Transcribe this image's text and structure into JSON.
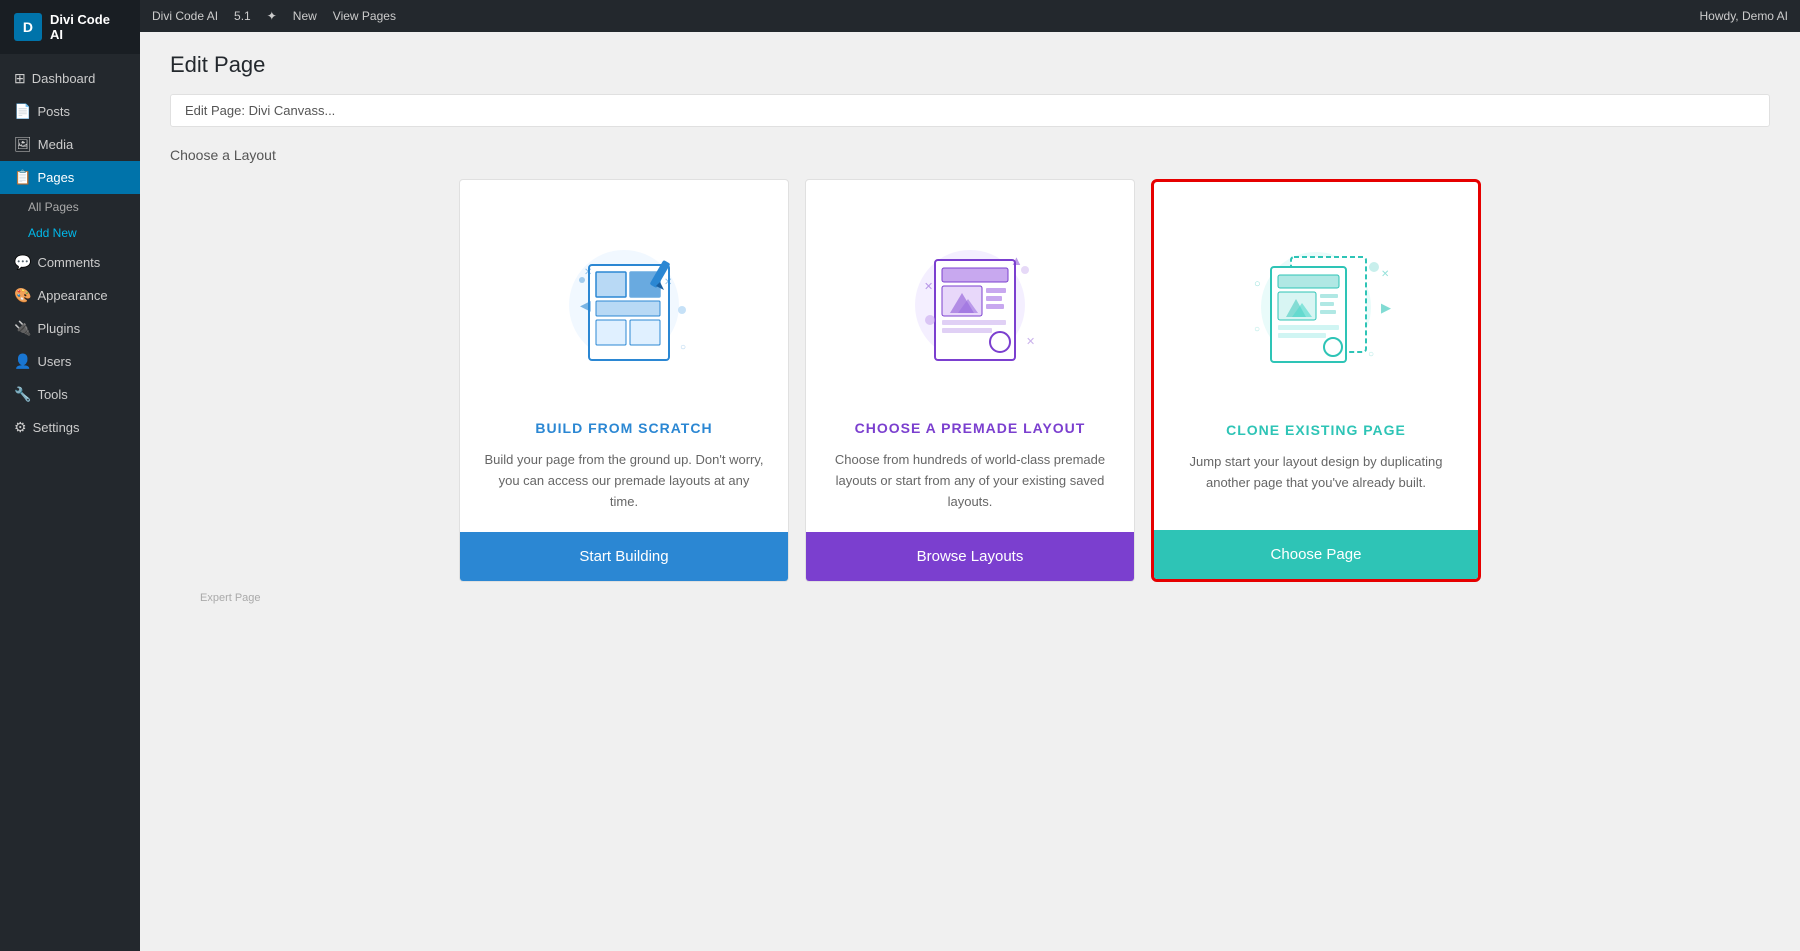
{
  "sidebar": {
    "logo": "Divi Code AI",
    "items": [
      {
        "label": "Dashboard",
        "icon": "⊞",
        "active": false
      },
      {
        "label": "Posts",
        "icon": "📄",
        "active": false
      },
      {
        "label": "Media",
        "icon": "🖼",
        "active": false
      },
      {
        "label": "Pages",
        "icon": "📋",
        "active": true
      },
      {
        "label": "All Pages",
        "icon": "",
        "active": false,
        "sub": true
      },
      {
        "label": "Add New",
        "icon": "",
        "active": true,
        "sub": true
      },
      {
        "label": "Comments",
        "icon": "💬",
        "active": false
      },
      {
        "label": "Appearance",
        "icon": "🎨",
        "active": false
      },
      {
        "label": "Plugins",
        "icon": "🔌",
        "active": false
      },
      {
        "label": "Users",
        "icon": "👤",
        "active": false
      },
      {
        "label": "Tools",
        "icon": "🔧",
        "active": false
      },
      {
        "label": "Settings",
        "icon": "⚙",
        "active": false
      }
    ]
  },
  "topbar": {
    "items": [
      "Divi Code AI",
      "5.1",
      "✦",
      "New",
      "View Pages"
    ],
    "right": "Howdy, Demo AI"
  },
  "page": {
    "title": "Edit Page",
    "breadcrumb": "Edit Page: Divi Canvass...",
    "options_label": "Choose a Layout"
  },
  "footer": {
    "text": "Expert Page"
  },
  "cards": [
    {
      "id": "scratch",
      "title": "BUILD FROM SCRATCH",
      "title_color": "blue",
      "description": "Build your page from the ground up. Don't worry, you can access our premade layouts at any time.",
      "button_label": "Start Building",
      "button_color": "blue-btn",
      "selected": false
    },
    {
      "id": "layout",
      "title": "CHOOSE A PREMADE LAYOUT",
      "title_color": "purple",
      "description": "Choose from hundreds of world-class premade layouts or start from any of your existing saved layouts.",
      "button_label": "Browse Layouts",
      "button_color": "purple-btn",
      "selected": false
    },
    {
      "id": "clone",
      "title": "CLONE EXISTING PAGE",
      "title_color": "teal",
      "description": "Jump start your layout design by duplicating another page that you've already built.",
      "button_label": "Choose Page",
      "button_color": "teal-btn",
      "selected": true
    }
  ]
}
